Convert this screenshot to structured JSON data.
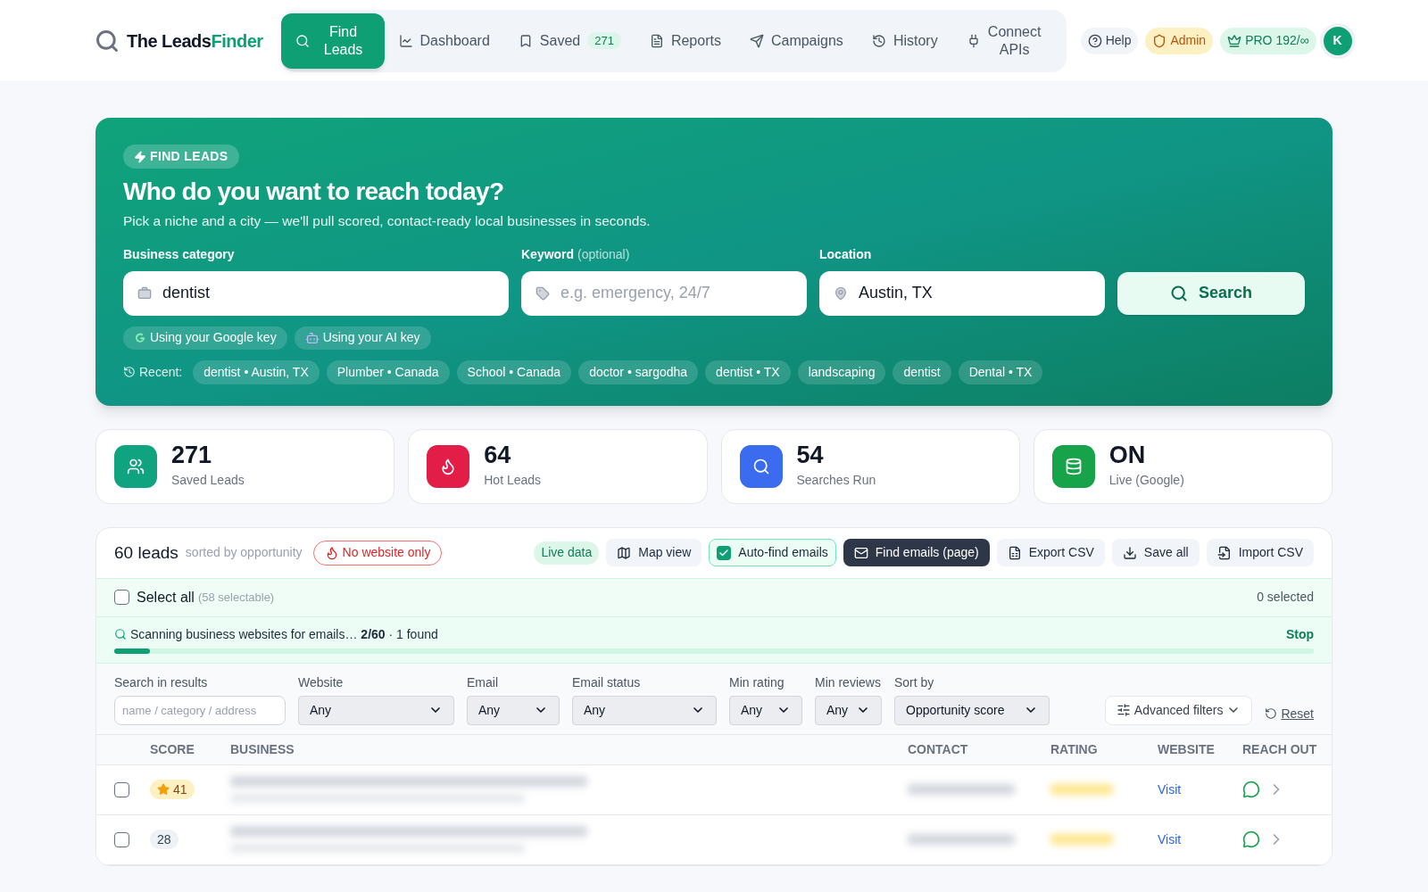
{
  "header": {
    "logo": {
      "first": "The Leads",
      "second": "Finder"
    },
    "nav": [
      {
        "label": "Find Leads",
        "selected": true
      },
      {
        "label": "Dashboard",
        "selected": false
      },
      {
        "label": "Saved",
        "selected": false,
        "badge": "271"
      },
      {
        "label": "Reports",
        "selected": false
      },
      {
        "label": "Campaigns",
        "selected": false
      },
      {
        "label": "History",
        "selected": false
      },
      {
        "label": "Connect APIs",
        "selected": false
      }
    ],
    "help": "Help",
    "admin": "Admin",
    "pro": {
      "label": "PRO",
      "quota": "192/∞"
    },
    "avatar": "K"
  },
  "hero": {
    "badge": "FIND LEADS",
    "title": "Who do you want to reach today?",
    "subtitle": "Pick a niche and a city — we'll pull scored, contact-ready local businesses in seconds.",
    "fields": [
      {
        "label": "Business category",
        "value": "dentist"
      },
      {
        "label": "Keyword",
        "hint": "(optional)",
        "placeholder": "e.g. emergency, 24/7"
      },
      {
        "label": "Location",
        "value": "Austin, TX"
      }
    ],
    "search_button": "Search",
    "key_chips": [
      "Using your Google key",
      "Using your AI key"
    ],
    "recent_label": "Recent:",
    "recent": [
      "dentist • Austin, TX",
      "Plumber • Canada",
      "School • Canada",
      "doctor • sargodha",
      "dentist • TX",
      "landscaping",
      "dentist",
      "Dental • TX"
    ]
  },
  "stats": [
    {
      "value": "271",
      "label": "Saved Leads",
      "color": "#10a37f"
    },
    {
      "value": "64",
      "label": "Hot Leads",
      "color": "#e11d48"
    },
    {
      "value": "54",
      "label": "Searches Run",
      "color": "#3b6cf0"
    },
    {
      "value": "ON",
      "label": "Live (Google)",
      "color": "#16a34a"
    }
  ],
  "results": {
    "count": "60 leads",
    "sorted": "sorted by opportunity",
    "no_website": "No website only",
    "live_data": "Live data",
    "map_view": "Map view",
    "auto_find": {
      "label": "Auto-find emails",
      "checked": true
    },
    "find_emails": "Find emails (page)",
    "export": "Export CSV",
    "save_all": "Save all",
    "import": "Import CSV",
    "select_all": {
      "label": "Select all",
      "hint": "(58 selectable)",
      "checked": false
    },
    "selected_count": "0 selected",
    "scan": {
      "text": "Scanning business websites for emails…",
      "progress": "2/60",
      "found": "· 1 found",
      "stop": "Stop",
      "level": 0.03
    },
    "filters": [
      {
        "label": "Search in results",
        "placeholder": "name / category / address",
        "kind": "text"
      },
      {
        "label": "Website",
        "value": "Any",
        "kind": "select"
      },
      {
        "label": "Email",
        "value": "Any",
        "kind": "select"
      },
      {
        "label": "Email status",
        "value": "Any",
        "kind": "select"
      },
      {
        "label": "Min rating",
        "value": "Any",
        "kind": "select"
      },
      {
        "label": "Min reviews",
        "value": "Any",
        "kind": "select"
      },
      {
        "label": "Sort by",
        "value": "Opportunity score",
        "kind": "select"
      }
    ],
    "advanced": "Advanced filters",
    "reset": "Reset",
    "columns": [
      "SCORE",
      "BUSINESS",
      "CONTACT",
      "RATING",
      "WEBSITE",
      "REACH OUT"
    ],
    "rows": [
      {
        "checked": false,
        "score": "41",
        "hot": true,
        "website": "Visit"
      },
      {
        "checked": false,
        "score": "28",
        "hot": false,
        "website": "Visit"
      }
    ]
  }
}
